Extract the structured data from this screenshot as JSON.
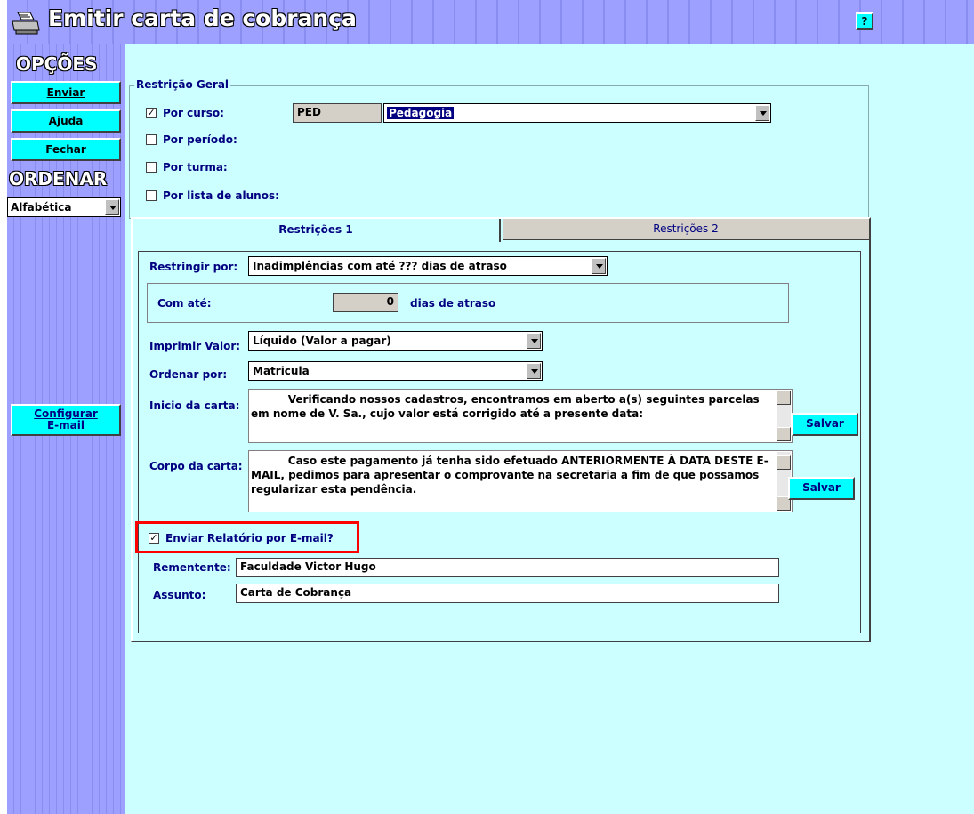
{
  "window": {
    "title": "Emitir carta de cobrança",
    "help_label": "?"
  },
  "sidebar": {
    "opcoes_heading": "OPÇÕES",
    "buttons": [
      {
        "label": "Enviar"
      },
      {
        "label": "Ajuda"
      },
      {
        "label": "Fechar"
      }
    ],
    "ordenar_heading": "ORDENAR",
    "ordenar_value": "Alfabética",
    "configurar_label_1": "Configurar",
    "configurar_label_2": "E-mail"
  },
  "restricao_geral": {
    "legend": "Restrição Geral",
    "por_curso": {
      "label": "Por curso:",
      "checked": true,
      "code": "PED",
      "name": "Pedagogia"
    },
    "por_periodo": {
      "label": "Por período:",
      "checked": false
    },
    "por_turma": {
      "label": "Por turma:",
      "checked": false
    },
    "por_lista": {
      "label": "Por lista de alunos:",
      "checked": false
    }
  },
  "tabs": [
    {
      "label": "Restrições 1",
      "active": true
    },
    {
      "label": "Restrições 2",
      "active": false
    }
  ],
  "restricoes1": {
    "restringir_label": "Restringir por:",
    "restringir_value": "Inadimplências com até ??? dias de atraso",
    "com_ate_label": "Com até:",
    "com_ate_value": "0",
    "dias_label": "dias de atraso",
    "imprimir_label": "Imprimir Valor:",
    "imprimir_value": "Líquido (Valor a pagar)",
    "ordenar_label": "Ordenar por:",
    "ordenar_value": "Matricula",
    "inicio_label": "Inicio da carta:",
    "inicio_text": "          Verificando nossos cadastros, encontramos em aberto a(s) seguintes parcelas em nome de V. Sa., cujo valor está corrigido até a presente data:",
    "corpo_label": "Corpo da carta:",
    "corpo_text": "          Caso este pagamento já tenha sido efetuado ANTERIORMENTE À DATA DESTE E-MAIL, pedimos para apresentar o comprovante na secretaria a fim de que possamos regularizar esta pendência.",
    "salvar_label": "Salvar",
    "enviar_email_label": "Enviar Relatório por E-mail?",
    "enviar_email_checked": true,
    "remetente_label": "Rementente:",
    "remetente_value": "Faculdade Victor Hugo",
    "assunto_label": "Assunto:",
    "assunto_value": "Carta de Cobrança"
  },
  "colors": {
    "main_bg": "#ccffff",
    "sidebar_bg": "#9da0ff",
    "button_bg": "#00ffff",
    "highlight": "#ff0000",
    "selection": "#000080"
  },
  "icons": [
    "printer-icon",
    "chevron-down-icon",
    "checkmark-icon",
    "scroll-up-icon",
    "scroll-down-icon"
  ]
}
